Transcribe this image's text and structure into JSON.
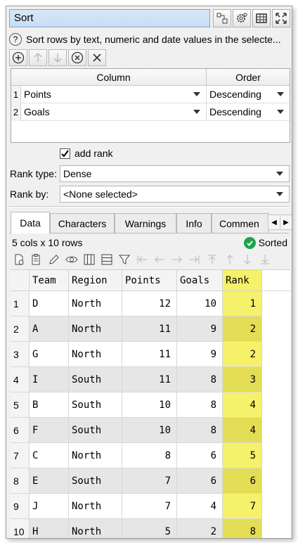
{
  "title": "Sort",
  "description": "Sort rows by text, numeric and date values in the selecte...",
  "sort_table": {
    "headers": {
      "column": "Column",
      "order": "Order"
    },
    "rows": [
      {
        "num": "1",
        "column": "Points",
        "order": "Descending"
      },
      {
        "num": "2",
        "column": "Goals",
        "order": "Descending"
      }
    ]
  },
  "add_rank": {
    "label": "add rank",
    "checked": true
  },
  "rank_type": {
    "label": "Rank type:",
    "value": "Dense"
  },
  "rank_by": {
    "label": "Rank by:",
    "value": "<None selected>"
  },
  "tabs": [
    "Data",
    "Characters",
    "Warnings",
    "Info",
    "Commen"
  ],
  "active_tab": "Data",
  "status": {
    "summary": "5 cols x 10 rows",
    "state": "Sorted"
  },
  "grid": {
    "columns": [
      "Team",
      "Region",
      "Points",
      "Goals",
      "Rank"
    ],
    "rows": [
      [
        "1",
        "D",
        "North",
        "12",
        "10",
        "1"
      ],
      [
        "2",
        "A",
        "North",
        "11",
        "9",
        "2"
      ],
      [
        "3",
        "G",
        "North",
        "11",
        "9",
        "2"
      ],
      [
        "4",
        "I",
        "South",
        "11",
        "8",
        "3"
      ],
      [
        "5",
        "B",
        "South",
        "10",
        "8",
        "4"
      ],
      [
        "6",
        "F",
        "South",
        "10",
        "8",
        "4"
      ],
      [
        "7",
        "C",
        "North",
        "8",
        "6",
        "5"
      ],
      [
        "8",
        "E",
        "South",
        "7",
        "6",
        "6"
      ],
      [
        "9",
        "J",
        "North",
        "7",
        "4",
        "7"
      ],
      [
        "10",
        "H",
        "North",
        "5",
        "2",
        "8"
      ]
    ]
  },
  "colors": {
    "rank_highlight": "#f5f16a",
    "title_bar": "#c7dcf3",
    "ok_green": "#1ea34b"
  }
}
